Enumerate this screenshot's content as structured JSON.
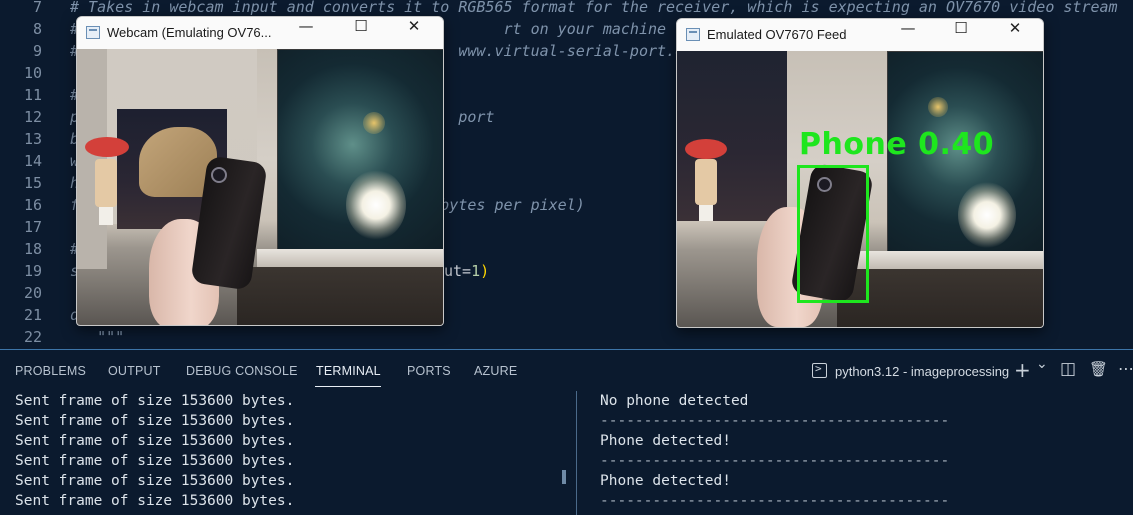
{
  "editor": {
    "lines": [
      {
        "num": "7",
        "text": "# Takes in webcam input and converts it to RGB565 format for the receiver, which is expecting an OV7670 video stream"
      },
      {
        "num": "8",
        "text": "#                                               rt on your machine"
      },
      {
        "num": "9",
        "text": "#                                          www.virtual-serial-port.org"
      },
      {
        "num": "10",
        "text": ""
      },
      {
        "num": "11",
        "text": "#"
      },
      {
        "num": "12",
        "text": "p                                          port"
      },
      {
        "num": "13",
        "text": "b"
      },
      {
        "num": "14",
        "text": "w"
      },
      {
        "num": "15",
        "text": "h"
      },
      {
        "num": "16",
        "text": "f                                     (2 bytes per pixel)"
      },
      {
        "num": "17",
        "text": ""
      },
      {
        "num": "18",
        "text": "#"
      },
      {
        "num": "19",
        "text": "s"
      },
      {
        "num": "20",
        "text": ""
      },
      {
        "num": "21",
        "text": "d"
      },
      {
        "num": "22",
        "text": "   \"\"\""
      }
    ],
    "line19_tail": "ut=",
    "line19_num": "1",
    "line19_paren": ")"
  },
  "webcam_window": {
    "title": "Webcam (Emulating OV76...",
    "minimize": "—",
    "maximize": "☐",
    "close": "✕"
  },
  "emulated_window": {
    "title": "Emulated OV7670 Feed",
    "minimize": "—",
    "maximize": "☐",
    "close": "✕",
    "detection_label": "Phone 0.40",
    "detection_color": "#1ee61e"
  },
  "panel": {
    "tabs": [
      "PROBLEMS",
      "OUTPUT",
      "DEBUG CONSOLE",
      "TERMINAL",
      "PORTS",
      "AZURE"
    ],
    "active_tab": "TERMINAL",
    "terminal_name": "python3.12 - imageprocessing",
    "icons": {
      "add": "+",
      "dropdown": "⌄",
      "split": "◫",
      "trash": "🗑",
      "more": "⋯"
    },
    "left_terminal": [
      "Sent frame of size 153600 bytes.",
      "Sent frame of size 153600 bytes.",
      "Sent frame of size 153600 bytes.",
      "Sent frame of size 153600 bytes.",
      "Sent frame of size 153600 bytes.",
      "Sent frame of size 153600 bytes."
    ],
    "right_terminal": [
      "No phone detected",
      "----------------------------------------",
      "Phone detected!",
      "----------------------------------------",
      "Phone detected!",
      "----------------------------------------"
    ]
  },
  "colors": {
    "editor_bg": "#0b1a2e",
    "comment": "#7f93ab",
    "accent_border": "#3d75a8",
    "detection": "#1ee61e"
  }
}
